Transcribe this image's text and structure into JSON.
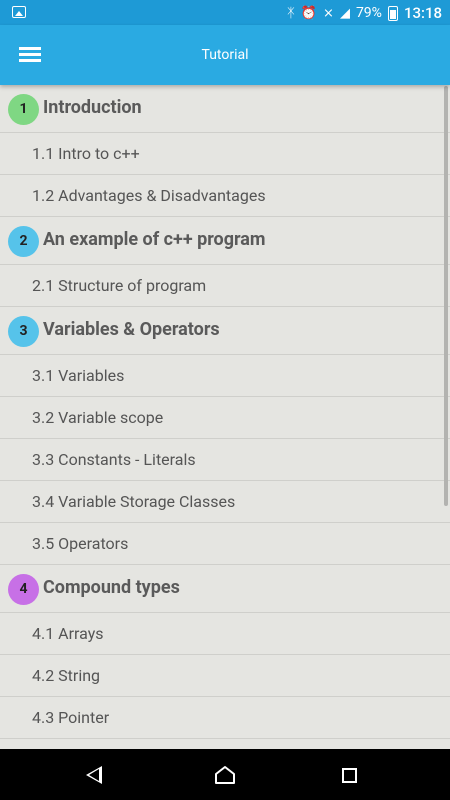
{
  "status_bar": {
    "battery_text": "79%",
    "time": "13:18",
    "icons": [
      "image-icon",
      "bluetooth-icon",
      "alarm-icon",
      "no-sim-signal-icon",
      "signal-icon",
      "battery-icon"
    ]
  },
  "app_bar": {
    "title": "Tutorial",
    "menu_icon": "hamburger-menu-icon"
  },
  "sections": [
    {
      "number": "1",
      "title": "Introduction",
      "badge_color": "#7fd783",
      "items": [
        "1.1 Intro to c++",
        "1.2 Advantages & Disadvantages"
      ]
    },
    {
      "number": "2",
      "title": "An example of c++ program",
      "badge_color": "#56c3ea",
      "items": [
        "2.1 Structure of program"
      ]
    },
    {
      "number": "3",
      "title": "Variables & Operators",
      "badge_color": "#56c3ea",
      "items": [
        "3.1 Variables",
        "3.2 Variable scope",
        "3.3 Constants - Literals",
        "3.4 Variable Storage Classes",
        "3.5 Operators"
      ]
    },
    {
      "number": "4",
      "title": "Compound types",
      "badge_color": "#c770e6",
      "items": [
        "4.1 Arrays",
        "4.2 String",
        "4.3 Pointer"
      ]
    }
  ],
  "nav_bar": {
    "icons": [
      "back-icon",
      "home-icon",
      "recent-apps-icon"
    ]
  }
}
